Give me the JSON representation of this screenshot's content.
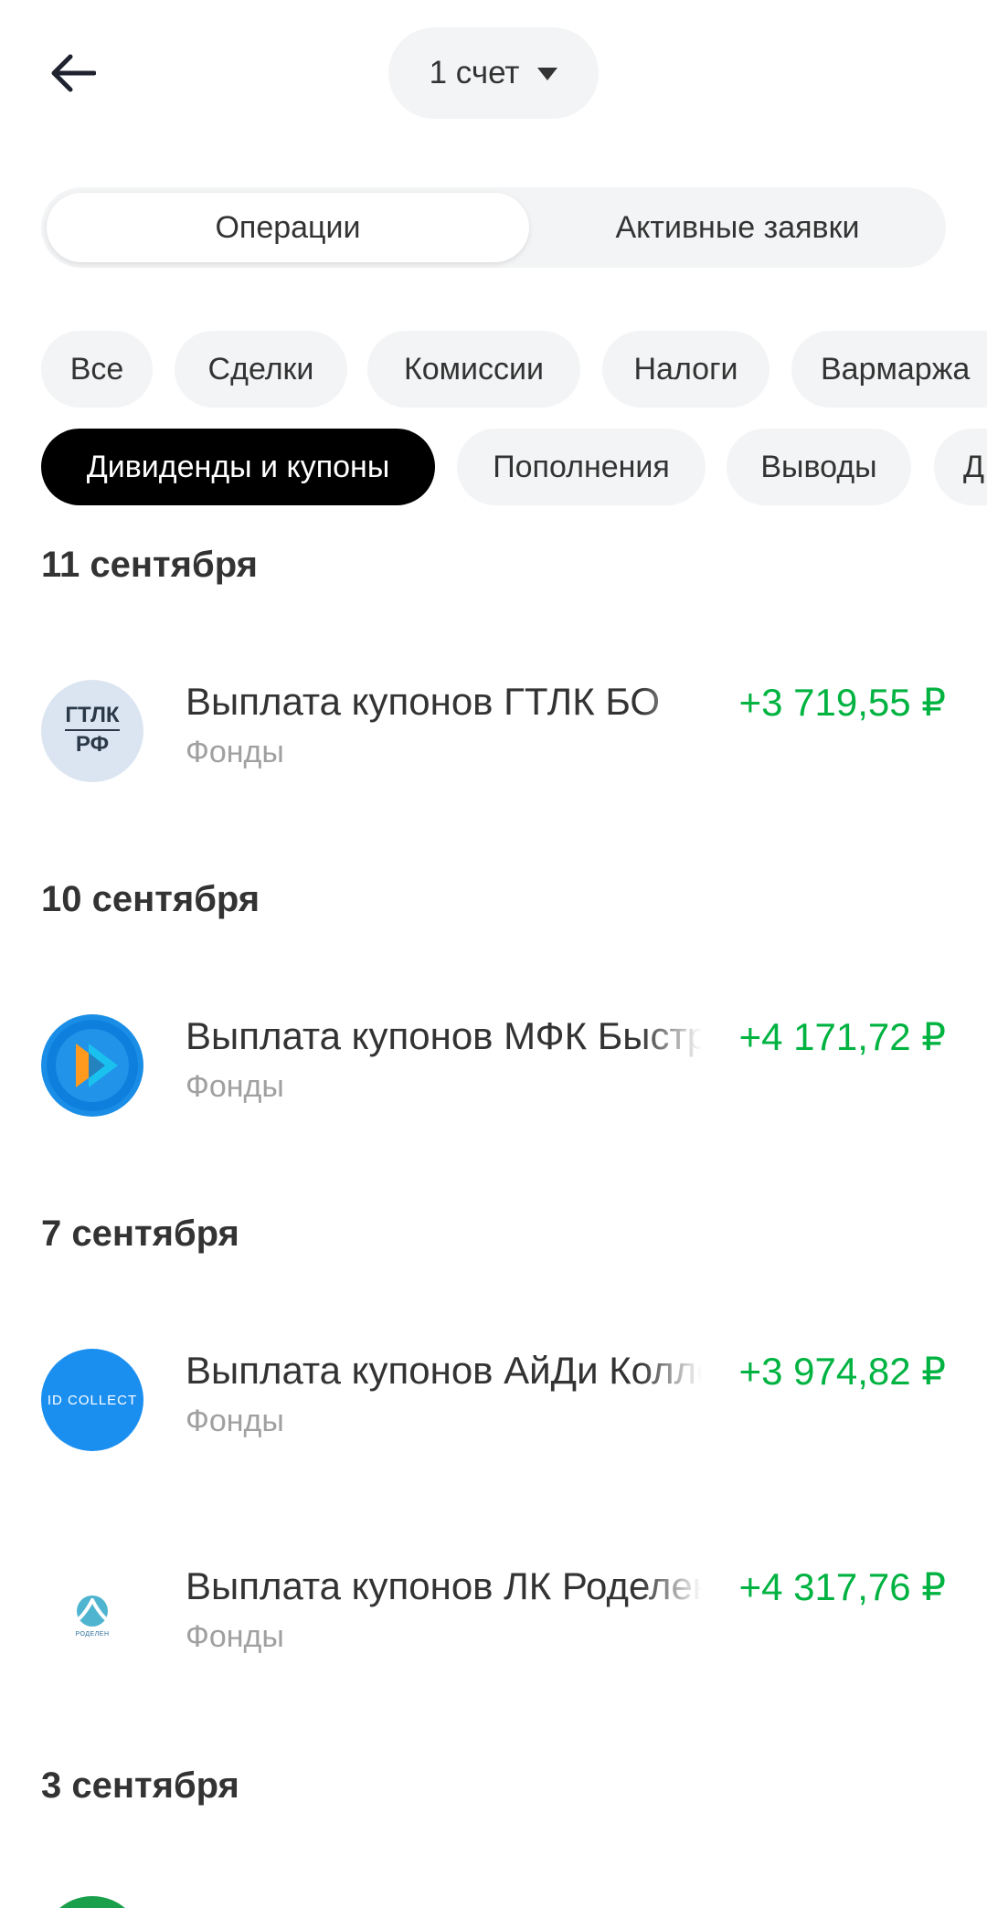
{
  "header": {
    "account_label": "1 счет"
  },
  "tabs": {
    "operations": "Операции",
    "active_orders": "Активные заявки"
  },
  "filters_row1": [
    "Все",
    "Сделки",
    "Комиссии",
    "Налоги",
    "Вармаржа"
  ],
  "filters_row2": [
    "Дивиденды и купоны",
    "Пополнения",
    "Выводы",
    "Д"
  ],
  "groups": [
    {
      "date": "11 сентября",
      "items": [
        {
          "title": "Выплата купонов ГТЛК БО",
          "subtitle": "Фонды",
          "amount": "+3 719,55 ₽",
          "logo": {
            "line1": "ГТЛК",
            "line2": "РФ"
          }
        }
      ]
    },
    {
      "date": "10 сентября",
      "items": [
        {
          "title": "Выплата купонов МФК Быстроденьги",
          "subtitle": "Фонды",
          "amount": "+4 171,72 ₽",
          "logo": {
            "icon": "play-logo-icon"
          }
        }
      ]
    },
    {
      "date": "7 сентября",
      "items": [
        {
          "title": "Выплата купонов АйДи Коллект",
          "subtitle": "Фонды",
          "amount": "+3 974,82 ₽",
          "logo": {
            "text": "ID COLLECT"
          }
        },
        {
          "title": "Выплата купонов ЛК Роделен",
          "subtitle": "Фонды",
          "amount": "+4 317,76 ₽",
          "logo": {
            "text": "РОДЕЛЕН"
          }
        }
      ]
    },
    {
      "date": "3 сентября",
      "items": []
    }
  ],
  "colors": {
    "positive_amount": "#00b341",
    "chip_bg": "#f3f4f5",
    "chip_active_bg": "#000000"
  }
}
